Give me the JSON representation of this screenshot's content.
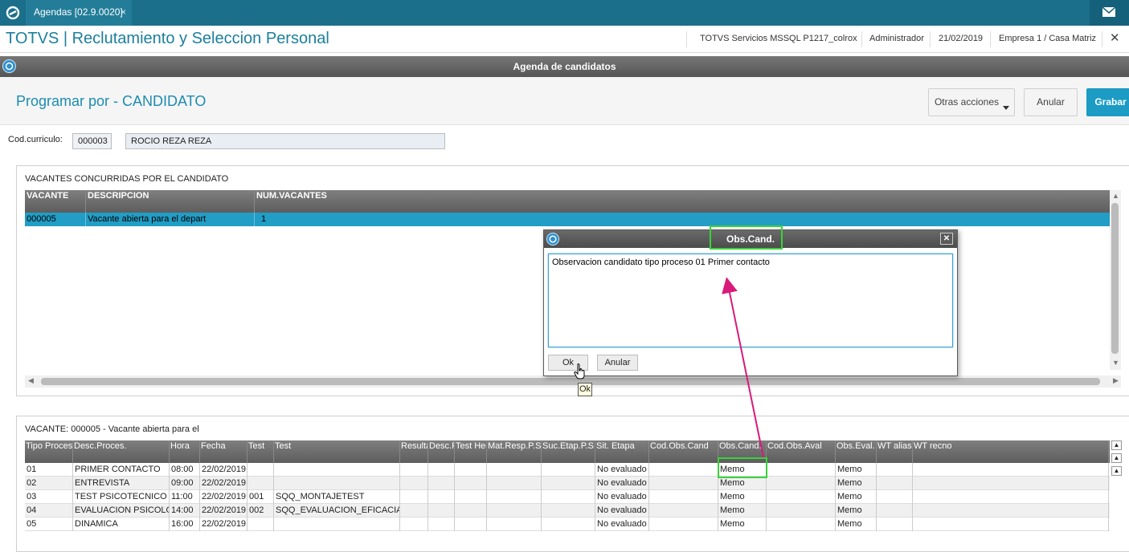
{
  "tabbar": {
    "tab_label": "Agendas [02.9.0020]",
    "tab_close": "×"
  },
  "header": {
    "app_title": "TOTVS | Reclutamiento y Seleccion Personal",
    "server": "TOTVS Servicios MSSQL P1217_colrox",
    "user": "Administrador",
    "date": "21/02/2019",
    "company": "Empresa 1 / Casa Matriz",
    "close": "✕"
  },
  "window_title": "Agenda de candidatos",
  "toolbar": {
    "page_title": "Programar por - CANDIDATO",
    "otras_acciones": "Otras acciones",
    "anular": "Anular",
    "grabar": "Grabar"
  },
  "candidate": {
    "label": "Cod.curriculo:",
    "code": "000003",
    "name": "ROCIO REZA REZA"
  },
  "vacantes_grid": {
    "title": "VACANTES CONCURRIDAS POR EL CANDIDATO",
    "headers": [
      "VACANTE",
      "DESCRIPCION",
      "NUM.VACANTES"
    ],
    "rows": [
      [
        "000005",
        "Vacante abierta para el depart",
        "1"
      ]
    ]
  },
  "procesos_grid": {
    "title": "VACANTE: 000005 - Vacante abierta para el",
    "headers": [
      "Tipo Proceso",
      "Desc.Proces.",
      "Hora",
      "Fecha",
      "Test",
      "Test",
      "Resultado",
      "Desc.Res.",
      "Test Hecho",
      "Mat.Resp.P.S",
      "Suc.Etap.P.S",
      "Sit. Etapa",
      "Cod.Obs.Cand",
      "Obs.Cand.",
      "Cod.Obs.Aval",
      "Obs.Eval.",
      "WT alias",
      "WT recno"
    ],
    "rows": [
      [
        "01",
        "PRIMER CONTACTO",
        "08:00",
        "22/02/2019",
        "",
        "",
        "",
        "",
        "",
        "",
        "",
        "No evaluado",
        "",
        "Memo",
        "",
        "Memo",
        "",
        ""
      ],
      [
        "02",
        "ENTREVISTA",
        "09:00",
        "22/02/2019",
        "",
        "",
        "",
        "",
        "",
        "",
        "",
        "No evaluado",
        "",
        "Memo",
        "",
        "Memo",
        "",
        ""
      ],
      [
        "03",
        "TEST PSICOTECNICO",
        "11:00",
        "22/02/2019",
        "001",
        "SQQ_MONTAJETEST",
        "",
        "",
        "",
        "",
        "",
        "No evaluado",
        "",
        "Memo",
        "",
        "Memo",
        "",
        ""
      ],
      [
        "04",
        "EVALUACION PSICOLOGICA",
        "14:00",
        "22/02/2019",
        "002",
        "SQQ_EVALUACION_EFICACIA",
        "",
        "",
        "",
        "",
        "",
        "No evaluado",
        "",
        "Memo",
        "",
        "Memo",
        "",
        ""
      ],
      [
        "05",
        "DINAMICA",
        "16:00",
        "22/02/2019",
        "",
        "",
        "",
        "",
        "",
        "",
        "",
        "No evaluado",
        "",
        "Memo",
        "",
        "Memo",
        "",
        ""
      ]
    ]
  },
  "dialog": {
    "title": "Obs.Cand.",
    "close": "✕",
    "text": "Observacion candidato tipo proceso 01 Primer contacto",
    "ok": "Ok",
    "anular": "Anular",
    "tooltip": "Ok"
  },
  "colors": {
    "brand": "#1b6f8a",
    "accent": "#1c9bc4",
    "selected_row": "#229dc5",
    "highlight": "#38d438",
    "arrow": "#d81b7a"
  },
  "icons": [
    "app-logo-icon",
    "mail-icon",
    "window-icon",
    "caret-down-icon",
    "hand-cursor-icon"
  ]
}
